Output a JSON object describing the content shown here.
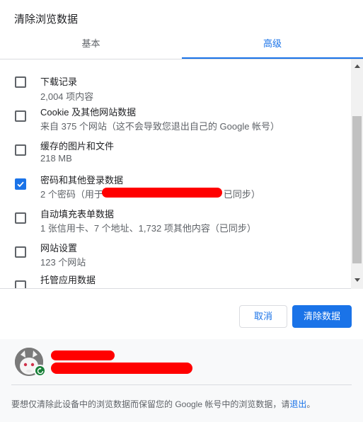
{
  "dialog": {
    "title": "清除浏览数据"
  },
  "tabs": [
    {
      "label": "基本",
      "selected": false
    },
    {
      "label": "高级",
      "selected": true
    }
  ],
  "items": [
    {
      "title": "下载记录",
      "subtitle": "2,004 项内容",
      "checked": false
    },
    {
      "title": "Cookie 及其他网站数据",
      "subtitle": "来自 375 个网站（这不会导致您退出自己的 Google 帐号）",
      "checked": false
    },
    {
      "title": "缓存的图片和文件",
      "subtitle": "218 MB",
      "checked": false
    },
    {
      "title": "密码和其他登录数据",
      "subtitle_prefix": "2 个密码（用于",
      "subtitle_suffix": "已同步）",
      "checked": true
    },
    {
      "title": "自动填充表单数据",
      "subtitle": "1 张信用卡、7 个地址、1,732 项其他内容（已同步）",
      "checked": false
    },
    {
      "title": "网站设置",
      "subtitle": "123 个网站",
      "checked": false
    },
    {
      "title": "托管应用数据",
      "subtitle": "",
      "checked": false
    }
  ],
  "buttons": {
    "cancel": "取消",
    "clear": "清除数据"
  },
  "footer": {
    "text_before_link": "要想仅清除此设备中的浏览数据而保留您的 Google 帐号中的浏览数据，请",
    "link": "退出",
    "text_after_link": "。"
  },
  "colors": {
    "accent": "#1a73e8",
    "redaction": "#ff0000",
    "sync_badge": "#188038"
  },
  "icons": {
    "checkbox_checked": "check-icon",
    "scroll_up": "arrow-up-icon",
    "scroll_down": "arrow-down-icon",
    "sync": "sync-icon"
  }
}
